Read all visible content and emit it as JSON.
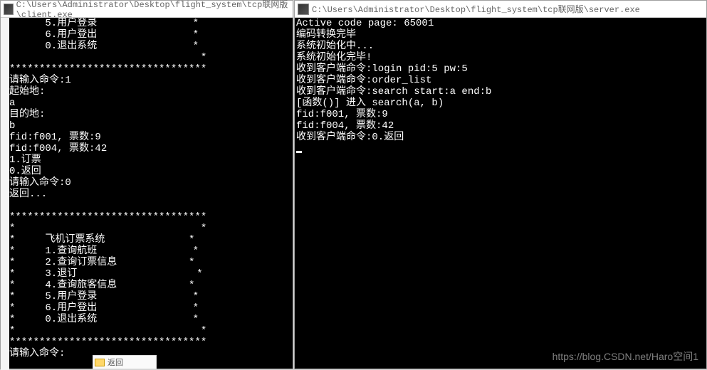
{
  "client_window": {
    "title": "C:\\Users\\Administrator\\Desktop\\flight_system\\tcp联网版\\client.exe",
    "lines": [
      "      5.用户登录                *",
      "      6.用户登出                *",
      "      0.退出系统                *",
      "                                *",
      "*********************************",
      "请输入命令:1",
      "起始地:",
      "a",
      "目的地:",
      "b",
      "fid:f001, 票数:9",
      "fid:f004, 票数:42",
      "1.订票",
      "0.返回",
      "请输入命令:0",
      "返回...",
      "",
      "*********************************",
      "*                               *",
      "*     飞机订票系统              *",
      "*     1.查询航班                *",
      "*     2.查询订票信息            *",
      "*     3.退订                    *",
      "*     4.查询旅客信息            *",
      "*     5.用户登录                *",
      "*     6.用户登出                *",
      "*     0.退出系统                *",
      "*                               *",
      "*********************************",
      "请输入命令:"
    ]
  },
  "server_window": {
    "title": "C:\\Users\\Administrator\\Desktop\\flight_system\\tcp联网版\\server.exe",
    "lines": [
      "Active code page: 65001",
      "编码转换完毕",
      "系统初始化中...",
      "系统初始化完毕!",
      "收到客户端命令:login pid:5 pw:5",
      "收到客户端命令:order_list",
      "收到客户端命令:search start:a end:b",
      "[函数()] 进入 search(a, b)",
      "fid:f001, 票数:9",
      "fid:f004, 票数:42",
      "收到客户端命令:0.返回"
    ]
  },
  "watermark": "https://blog.CSDN.net/Haro空间1",
  "bottom_label": "返回"
}
